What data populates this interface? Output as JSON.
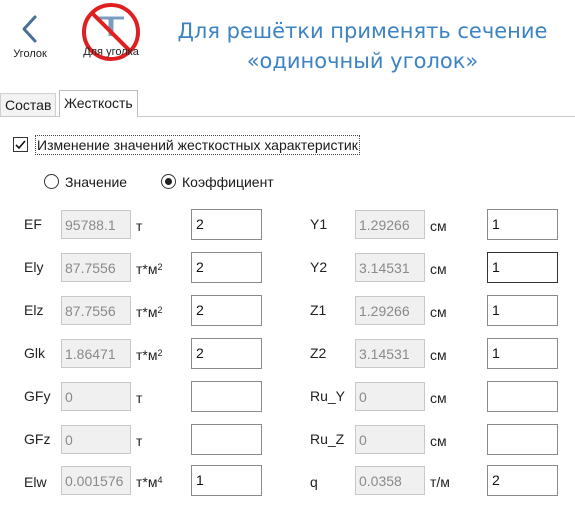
{
  "toolbar": {
    "back_label": "Уголок",
    "corner_label": "Для уголка"
  },
  "hint": "Для решётки применять сечение «одиночный уголок»",
  "tabs": [
    {
      "label": "Состав"
    },
    {
      "label": "Жесткость"
    }
  ],
  "stiffness": {
    "change_checkbox_label": "Изменение значений жесткостных характеристик",
    "change_checked": true,
    "mode_value_label": "Значение",
    "mode_coef_label": "Коэффициент",
    "selected_mode": "coefficient"
  },
  "left_rows": [
    {
      "name": "EF",
      "value": "95788.1",
      "unit": "т",
      "unit_sup": "",
      "input": "2"
    },
    {
      "name": "Ely",
      "value": "87.7556",
      "unit": "т*м",
      "unit_sup": "2",
      "input": "2"
    },
    {
      "name": "Elz",
      "value": "87.7556",
      "unit": "т*м",
      "unit_sup": "2",
      "input": "2"
    },
    {
      "name": "Glk",
      "value": "1.86471",
      "unit": "т*м",
      "unit_sup": "2",
      "input": "2"
    },
    {
      "name": "GFy",
      "value": "0",
      "unit": "т",
      "unit_sup": "",
      "input": ""
    },
    {
      "name": "GFz",
      "value": "0",
      "unit": "т",
      "unit_sup": "",
      "input": ""
    },
    {
      "name": "Elw",
      "value": "0.001576",
      "unit": "т*м",
      "unit_sup": "4",
      "input": "1"
    }
  ],
  "right_rows": [
    {
      "name": "Y1",
      "value": "1.29266",
      "unit": "см",
      "input": "1"
    },
    {
      "name": "Y2",
      "value": "3.14531",
      "unit": "см",
      "input": "1"
    },
    {
      "name": "Z1",
      "value": "1.29266",
      "unit": "см",
      "input": "1"
    },
    {
      "name": "Z2",
      "value": "3.14531",
      "unit": "см",
      "input": "1"
    },
    {
      "name": "Ru_Y",
      "value": "0",
      "unit": "см",
      "input": ""
    },
    {
      "name": "Ru_Z",
      "value": "0",
      "unit": "см",
      "input": ""
    },
    {
      "name": "q",
      "value": "0.0358",
      "unit": "т/м",
      "input": "2"
    }
  ],
  "colors": {
    "hint": "#3d83c4",
    "back_arrow": "#4a6f96",
    "prohibit": "#e02020"
  }
}
